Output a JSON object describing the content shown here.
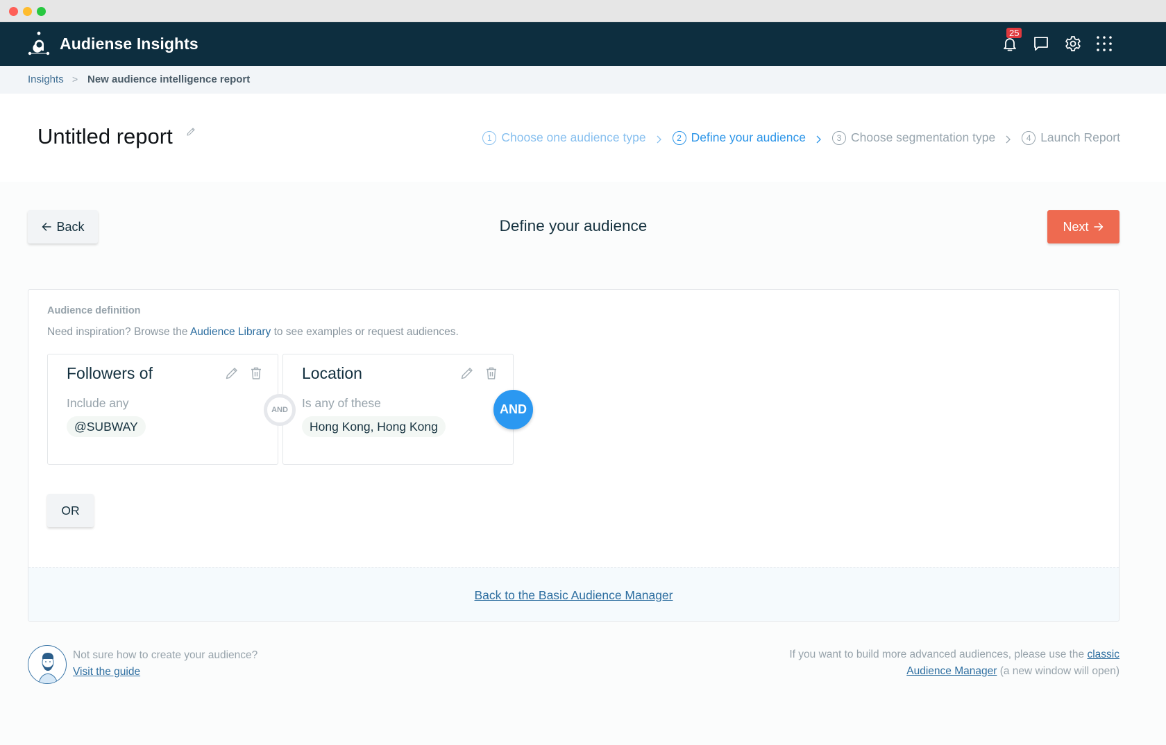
{
  "app": {
    "title": "Audiense Insights",
    "notification_count": "25",
    "icons": [
      "logo-icon",
      "bell-icon",
      "chat-icon",
      "gear-icon",
      "apps-grid-icon"
    ]
  },
  "breadcrumb": {
    "root": "Insights",
    "separator": ">",
    "current": "New audience intelligence report"
  },
  "header": {
    "report_title": "Untitled report",
    "steps": [
      {
        "num": "1",
        "label": "Choose one audience type",
        "state": "done"
      },
      {
        "num": "2",
        "label": "Define your audience",
        "state": "active"
      },
      {
        "num": "3",
        "label": "Choose segmentation type",
        "state": "todo"
      },
      {
        "num": "4",
        "label": "Launch Report",
        "state": "todo"
      }
    ]
  },
  "toolbar": {
    "back_label": "Back",
    "heading": "Define your audience",
    "next_label": "Next"
  },
  "definition": {
    "label": "Audience definition",
    "help_prefix": "Need inspiration? Browse the ",
    "help_link": "Audience Library",
    "help_suffix": " to see examples or request audiences.",
    "conditions": [
      {
        "title": "Followers of",
        "subtitle": "Include any",
        "values": [
          "@SUBWAY"
        ]
      },
      {
        "title": "Location",
        "subtitle": "Is any of these",
        "values": [
          "Hong Kong, Hong Kong"
        ]
      }
    ],
    "and_connector": "AND",
    "and_button": "AND",
    "or_button": "OR",
    "footer_link": "Back to the Basic Audience Manager"
  },
  "footer": {
    "guide_question": "Not sure how to create your audience?",
    "guide_link": "Visit the guide",
    "advanced_prefix": "If you want to build more advanced audiences, please use the ",
    "advanced_link": "classic Audience Manager",
    "advanced_suffix": " (a new window will open)"
  },
  "colors": {
    "nav_bg": "#0d2e3f",
    "accent_blue": "#2b98f1",
    "next_orange": "#ee6a50",
    "badge_red": "#e0393e",
    "link_blue": "#2d6ea0"
  }
}
